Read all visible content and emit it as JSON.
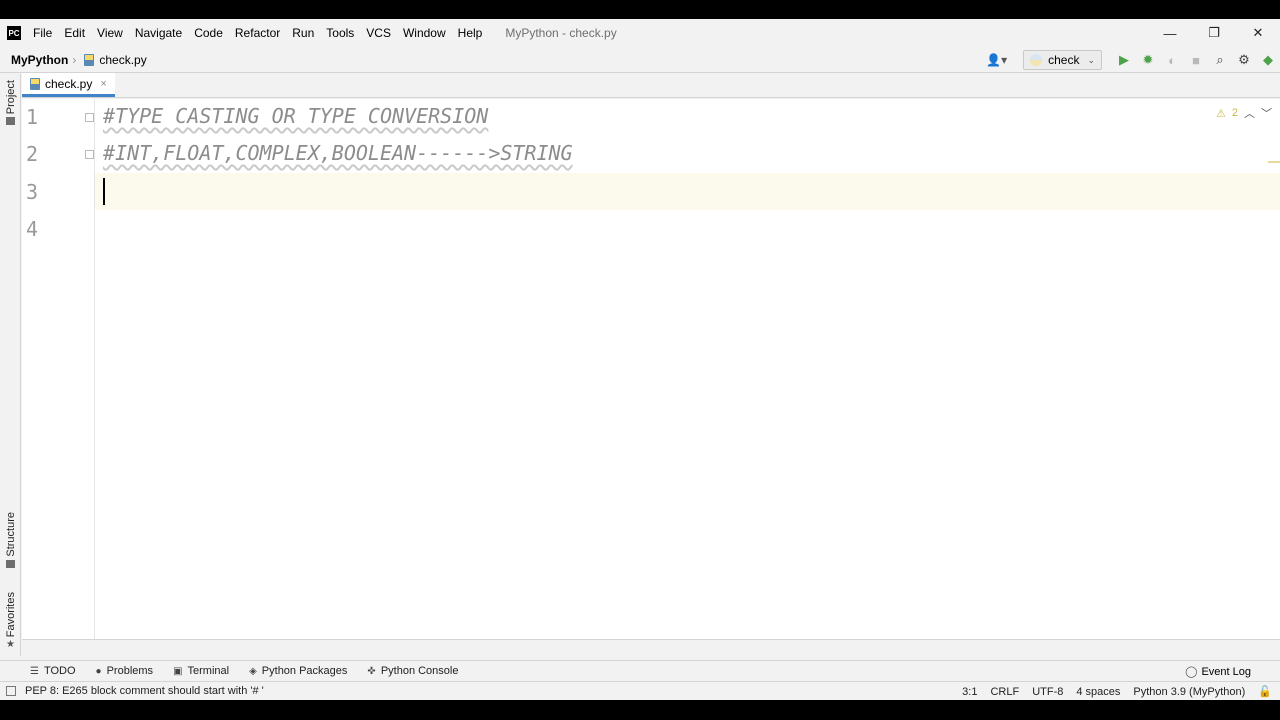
{
  "app": {
    "logo": "PC",
    "window_title": "MyPython - check.py"
  },
  "menu": [
    "File",
    "Edit",
    "View",
    "Navigate",
    "Code",
    "Refactor",
    "Run",
    "Tools",
    "VCS",
    "Window",
    "Help"
  ],
  "window_controls": {
    "minimize": "—",
    "restore": "❐",
    "close": "✕"
  },
  "navbar": {
    "project": "MyPython",
    "file": "check.py",
    "run_config": "check"
  },
  "left_strip": {
    "project_tab": "Project",
    "structure_tab": "Structure",
    "favorites_tab": "Favorites"
  },
  "editor_tab": {
    "label": "check.py",
    "close": "×"
  },
  "editor": {
    "lines": [
      {
        "number": "1",
        "text": "#TYPE CASTING OR TYPE CONVERSION"
      },
      {
        "number": "2",
        "text": "#INT,FLOAT,COMPLEX,BOOLEAN------>STRING"
      },
      {
        "number": "3",
        "text": ""
      },
      {
        "number": "4",
        "text": ""
      }
    ],
    "warning_count": "2",
    "current_line": 3
  },
  "tool_windows": {
    "todo": "TODO",
    "problems": "Problems",
    "terminal": "Terminal",
    "python_packages": "Python Packages",
    "python_console": "Python Console",
    "event_log": "Event Log"
  },
  "status": {
    "message": "PEP 8: E265 block comment should start with '# '",
    "position": "3:1",
    "line_separator": "CRLF",
    "encoding": "UTF-8",
    "indent": "4 spaces",
    "interpreter": "Python 3.9 (MyPython)"
  },
  "colors": {
    "accent": "#4083c9",
    "run_green": "#4ea34a",
    "comment_grey": "#8c8c8c",
    "current_line_bg": "#fcfaed"
  }
}
